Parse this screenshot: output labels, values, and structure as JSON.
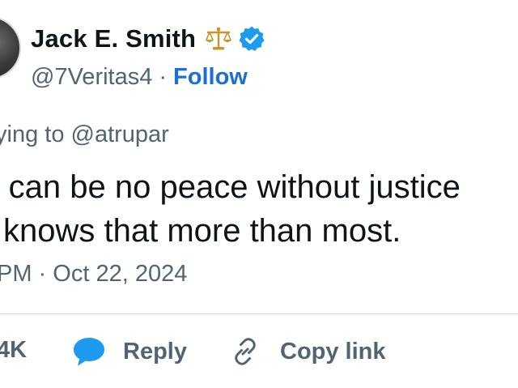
{
  "author": {
    "display_name": "Jack E. Smith",
    "handle": "@7Veritas4",
    "separator": "·",
    "follow_label": "Follow",
    "emoji_icon": "balance-scale-icon",
    "verified_icon": "verified-badge-icon"
  },
  "tweet": {
    "replying_to": "ying to @atrupar",
    "line1": "re can be no peace without justice",
    "line2": "knows that more than most.",
    "timestamp": "PM · Oct 22, 2024"
  },
  "actions": {
    "likes_count": "4K",
    "reply_label": "Reply",
    "copy_link_label": "Copy link"
  },
  "colors": {
    "link_blue": "#1d6fd8",
    "secondary_text": "#536471",
    "reply_icon_blue": "#1d9bf0",
    "verified_blue": "#1d9bf0"
  }
}
